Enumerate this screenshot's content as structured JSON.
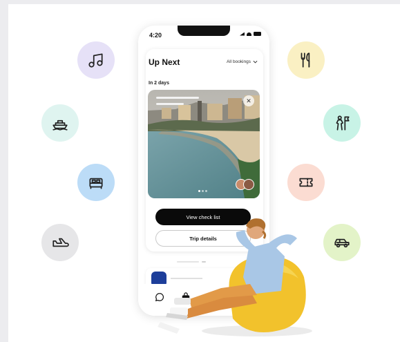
{
  "status_bar": {
    "time": "4:20"
  },
  "trip": {
    "title": "Up Next",
    "filter_label": "All bookings",
    "when": "In 2 days",
    "primary_action": "View check list",
    "secondary_action": "Trip details"
  },
  "side_icons": [
    {
      "icon": "music-icon",
      "color": "#e6e1f7"
    },
    {
      "icon": "ship-icon",
      "color": "#dff4f0"
    },
    {
      "icon": "bed-icon",
      "color": "#bcdcf7"
    },
    {
      "icon": "flight-icon",
      "color": "#e6e6e8"
    },
    {
      "icon": "restaurant-icon",
      "color": "#faf0c3"
    },
    {
      "icon": "guide-icon",
      "color": "#c8f3e6"
    },
    {
      "icon": "ticket-icon",
      "color": "#fbdcd2"
    },
    {
      "icon": "car-icon",
      "color": "#e3f3c8"
    }
  ],
  "tabs": [
    "chat-icon",
    "bag-icon",
    "explore-icon"
  ]
}
